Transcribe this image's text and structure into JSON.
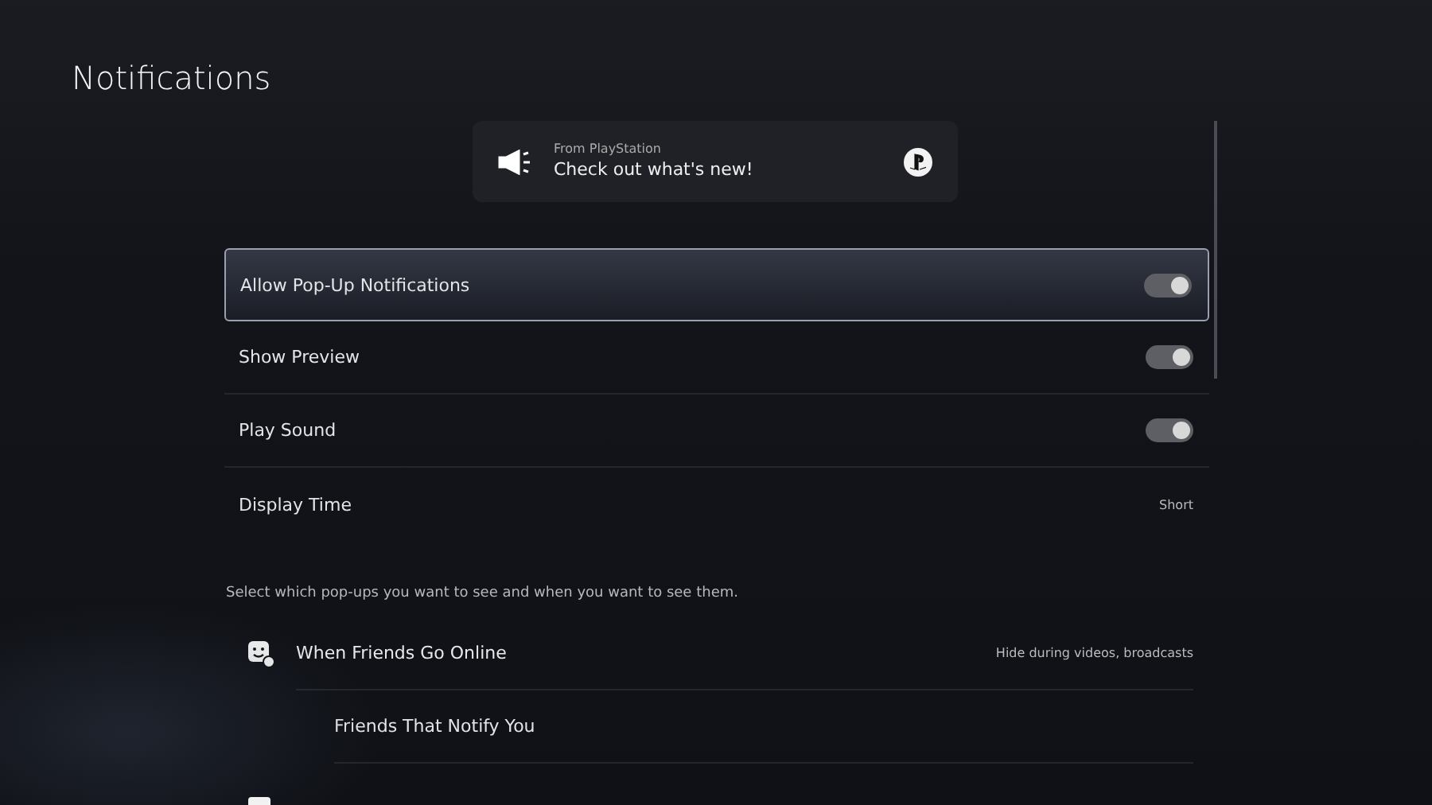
{
  "title": "Notifications",
  "preview": {
    "source": "From PlayStation",
    "message": "Check out what's new!"
  },
  "settings": [
    {
      "kind": "toggle",
      "label": "Allow Pop-Up Notifications",
      "on": true,
      "selected": true
    },
    {
      "kind": "toggle",
      "label": "Show Preview",
      "on": true,
      "selected": false
    },
    {
      "kind": "toggle",
      "label": "Play Sound",
      "on": true,
      "selected": false
    },
    {
      "kind": "value",
      "label": "Display Time",
      "value": "Short",
      "selected": false
    }
  ],
  "description": "Select which pop-ups you want to see and when you want to see them.",
  "categories": [
    {
      "label": "When Friends Go Online",
      "value": "Hide during videos, broadcasts",
      "children": [
        {
          "label": "Friends That Notify You"
        }
      ]
    }
  ]
}
